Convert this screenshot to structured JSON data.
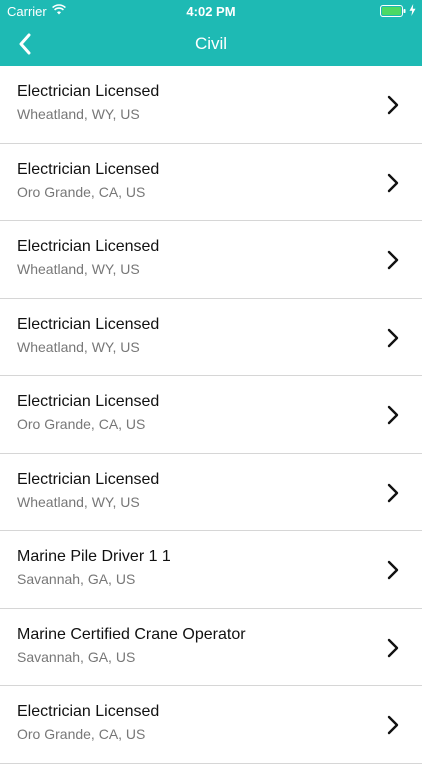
{
  "status_bar": {
    "carrier": "Carrier",
    "time": "4:02 PM",
    "icons": [
      "wifi-icon",
      "battery-icon",
      "charging-bolt-icon"
    ]
  },
  "nav": {
    "title": "Civil",
    "back_icon": "chevron-left-icon"
  },
  "colors": {
    "header_background": "#1ebab4",
    "header_text": "#ffffff",
    "title_text": "#111111",
    "subtitle_text": "#777777",
    "divider": "#d6d6d6"
  },
  "jobs": [
    {
      "title": "Electrician Licensed",
      "location": "Wheatland, WY, US"
    },
    {
      "title": "Electrician Licensed",
      "location": "Oro Grande, CA, US"
    },
    {
      "title": "Electrician Licensed",
      "location": "Wheatland, WY, US"
    },
    {
      "title": "Electrician Licensed",
      "location": "Wheatland, WY, US"
    },
    {
      "title": "Electrician Licensed",
      "location": "Oro Grande, CA, US"
    },
    {
      "title": "Electrician Licensed",
      "location": "Wheatland, WY, US"
    },
    {
      "title": "Marine Pile Driver 1 1",
      "location": "Savannah, GA, US"
    },
    {
      "title": "Marine Certified Crane Operator",
      "location": "Savannah, GA, US"
    },
    {
      "title": "Electrician Licensed",
      "location": "Oro Grande, CA, US"
    }
  ]
}
